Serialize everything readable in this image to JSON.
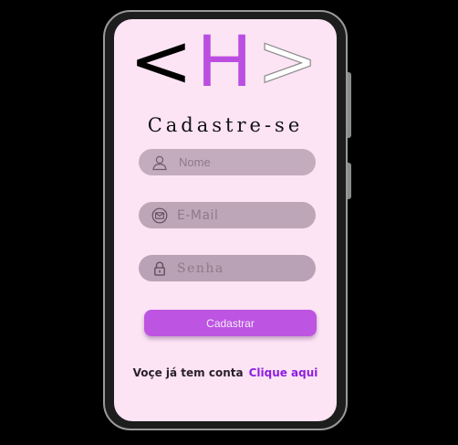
{
  "logo": {
    "left": "<",
    "letter": "H",
    "right": ">"
  },
  "title": "Cadastre-se",
  "form": {
    "name_placeholder": "Nome",
    "email_placeholder": "E-Mail",
    "password_placeholder": "Senha",
    "submit_label": "Cadastrar"
  },
  "footer": {
    "question": "Voçe já tem conta",
    "link": "Clique aqui"
  },
  "icons": {
    "name": "user-icon",
    "email": "email-icon",
    "password": "lock-icon"
  },
  "colors": {
    "screen_background": "#fce4f4",
    "logo_accent": "#bb4ee0",
    "button": "#bd55e2",
    "link": "#8d1ee0",
    "field_background": "#c0a8bb"
  }
}
